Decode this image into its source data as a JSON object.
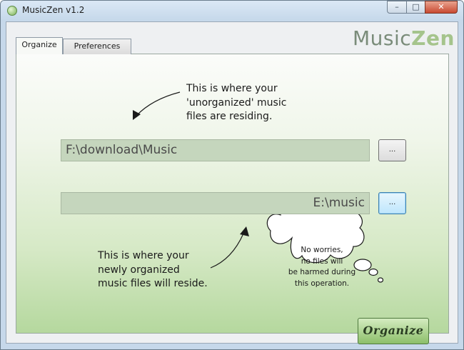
{
  "window": {
    "title": "MusicZen v1.2",
    "app_icon": "musiczen-app-icon",
    "controls": {
      "minimize": "minimize-icon",
      "maximize": "maximize-icon",
      "close": "close-icon"
    }
  },
  "logo": {
    "part1": "Music",
    "part2": "Zen"
  },
  "tabs": [
    {
      "label": "Organize",
      "active": true
    },
    {
      "label": "Preferences",
      "active": false
    }
  ],
  "organize_panel": {
    "source_hint_lines": [
      "This is where your",
      "'unorganized' music",
      "files are residing."
    ],
    "source_path": "F:\\download\\Music",
    "source_browse_label": "...",
    "dest_path": "E:\\music",
    "dest_browse_label": "...",
    "dest_hint_lines": [
      "This is where your",
      "newly organized",
      "music files will reside."
    ],
    "cloud_lines": [
      "No worries,",
      "no files will",
      "be harmed during",
      "this operation."
    ],
    "organize_button": "Organize"
  },
  "colors": {
    "panel_top": "#fbfcfa",
    "panel_bottom": "#b5d89e",
    "path_field": "#c5d6bd",
    "logo_music": "#7a8c7a",
    "logo_zen": "#a5c48c",
    "focus_button": "#bee6fd"
  }
}
